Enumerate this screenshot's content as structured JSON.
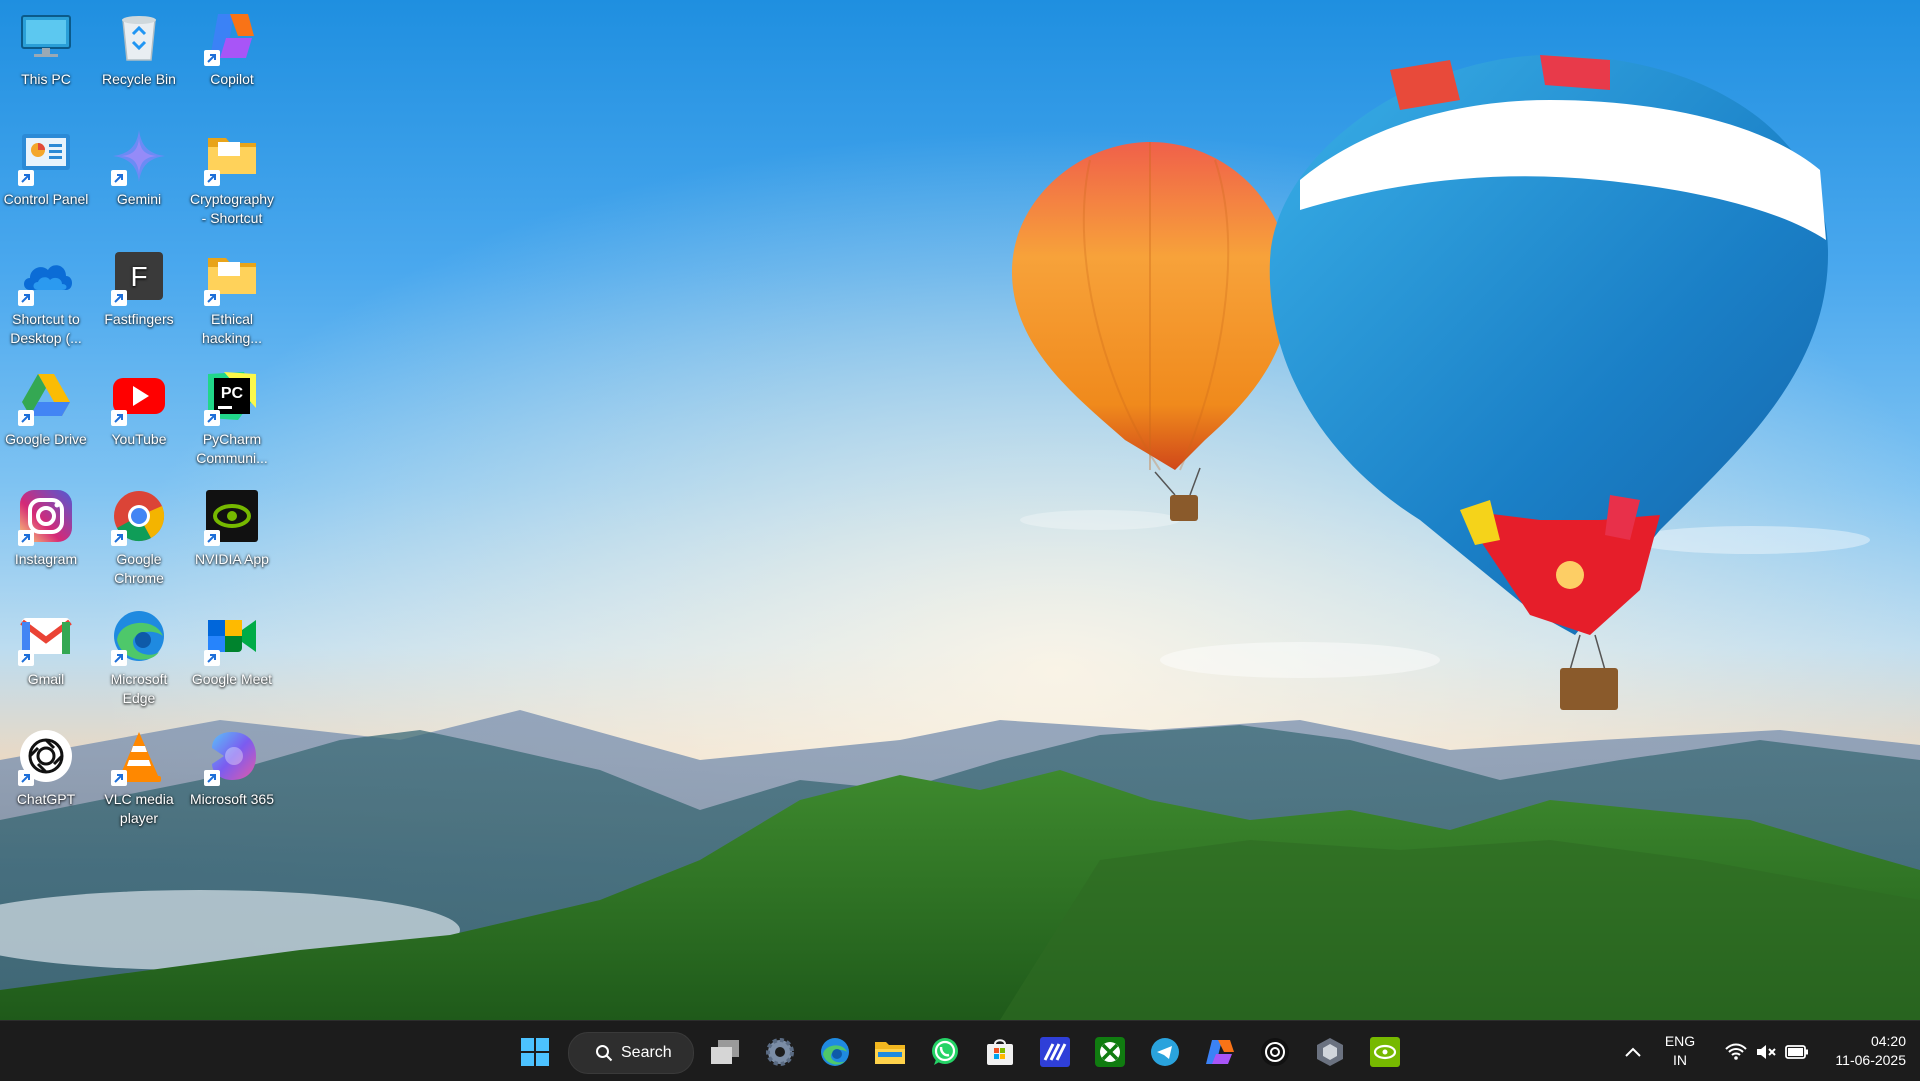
{
  "desktop": {
    "icons": [
      {
        "label": "This PC",
        "icon": "monitor-icon"
      },
      {
        "label": "Recycle Bin",
        "icon": "recycle-bin-icon"
      },
      {
        "label": "Copilot",
        "icon": "copilot-icon"
      },
      {
        "label": "Control Panel",
        "icon": "control-panel-icon"
      },
      {
        "label": "Gemini",
        "icon": "gemini-icon"
      },
      {
        "label": "Cryptography - Shortcut",
        "icon": "folder-icon"
      },
      {
        "label": "Shortcut to Desktop (...",
        "icon": "onedrive-icon"
      },
      {
        "label": "Fastfingers",
        "icon": "fastfingers-icon",
        "letter": "F"
      },
      {
        "label": "Ethical hacking...",
        "icon": "folder-icon"
      },
      {
        "label": "Google Drive",
        "icon": "google-drive-icon"
      },
      {
        "label": "YouTube",
        "icon": "youtube-icon"
      },
      {
        "label": "PyCharm Communi...",
        "icon": "pycharm-icon",
        "letter": "PC"
      },
      {
        "label": "Instagram",
        "icon": "instagram-icon"
      },
      {
        "label": "Google Chrome",
        "icon": "chrome-icon"
      },
      {
        "label": "NVIDIA App",
        "icon": "nvidia-icon"
      },
      {
        "label": "Gmail",
        "icon": "gmail-icon"
      },
      {
        "label": "Microsoft Edge",
        "icon": "edge-icon"
      },
      {
        "label": "Google Meet",
        "icon": "google-meet-icon"
      },
      {
        "label": "ChatGPT",
        "icon": "chatgpt-icon"
      },
      {
        "label": "VLC media player",
        "icon": "vlc-icon"
      },
      {
        "label": "Microsoft 365",
        "icon": "microsoft-365-icon"
      }
    ]
  },
  "taskbar": {
    "search_label": "Search",
    "pinned": [
      "start-icon",
      "task-view-icon",
      "settings-icon",
      "edge-icon",
      "file-explorer-icon",
      "whatsapp-icon",
      "microsoft-store-icon",
      "app-icon",
      "xbox-icon",
      "telegram-icon",
      "copilot-icon",
      "chatgpt-icon",
      "app-icon",
      "nvidia-icon"
    ],
    "tray": {
      "language": "ENG",
      "region": "IN",
      "time": "04:20",
      "date": "11-06-2025"
    }
  },
  "colors": {
    "taskbar_bg": "#1c1c1c",
    "accent": "#0078d4"
  }
}
